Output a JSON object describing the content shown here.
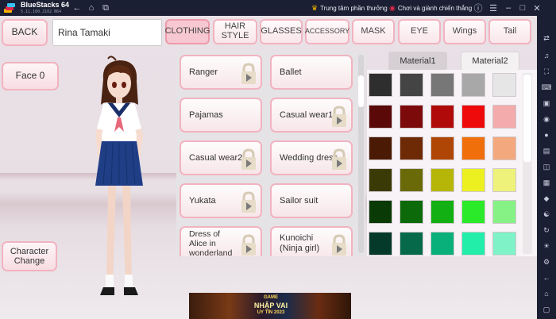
{
  "window": {
    "app_name": "BlueStacks 64",
    "version": "5.11.100.2102 N64",
    "promo1": "Trung tâm phần thưởng",
    "promo2": "Chơi và giành chiến thắng"
  },
  "game": {
    "back_label": "BACK",
    "name_value": "Rina Tamaki",
    "face_label": "Face 0",
    "character_change_label": "Character\nChange",
    "tabs": [
      {
        "label": "CLOTHING",
        "active": true
      },
      {
        "label": "HAIR\nSTYLE",
        "active": false
      },
      {
        "label": "GLASSES",
        "active": false
      },
      {
        "label": "ACCESSORY",
        "active": false
      },
      {
        "label": "MASK",
        "active": false
      },
      {
        "label": "EYE",
        "active": false
      },
      {
        "label": "Wings",
        "active": false
      },
      {
        "label": "Tail",
        "active": false
      }
    ],
    "clothing_items": [
      {
        "label": "Ranger",
        "locked": true
      },
      {
        "label": "Ballet",
        "locked": false
      },
      {
        "label": "Pajamas",
        "locked": false
      },
      {
        "label": "Casual wear1",
        "locked": true
      },
      {
        "label": "Casual wear2",
        "locked": true
      },
      {
        "label": "Wedding dress",
        "locked": true
      },
      {
        "label": "Yukata",
        "locked": true
      },
      {
        "label": "Sailor suit",
        "locked": false
      },
      {
        "label": "Dress of Alice in wonderland",
        "locked": true
      },
      {
        "label": "Kunoichi (Ninja girl)",
        "locked": true
      }
    ],
    "lock_ad_text": "AD",
    "material_tabs": [
      "Material1",
      "Material2"
    ],
    "palette_rows": [
      [
        "#2e2e2e",
        "#444444",
        "#777777",
        "#a8a8a8",
        "#e6e6e6"
      ],
      [
        "#5a0808",
        "#7d0a0a",
        "#b00a0a",
        "#ee0a0a",
        "#f3abab"
      ],
      [
        "#4a1a04",
        "#6e2a05",
        "#b04605",
        "#f06f0a",
        "#f3a97d"
      ],
      [
        "#3a3a06",
        "#6a6a08",
        "#b6b608",
        "#ecf020",
        "#eef27a"
      ],
      [
        "#0a3a06",
        "#0c6a0a",
        "#12b012",
        "#2aea2a",
        "#86f286"
      ],
      [
        "#053a2a",
        "#066a4a",
        "#0ab07a",
        "#22eeaa",
        "#80f2c8"
      ]
    ],
    "ad_banner_text": {
      "line1": "GAME",
      "line2": "NHẬP VAI",
      "line3": "UY TÍN 2023"
    },
    "colors": {
      "accent_border": "#f2b3c0",
      "active_tab": "#f7c8d2"
    }
  }
}
